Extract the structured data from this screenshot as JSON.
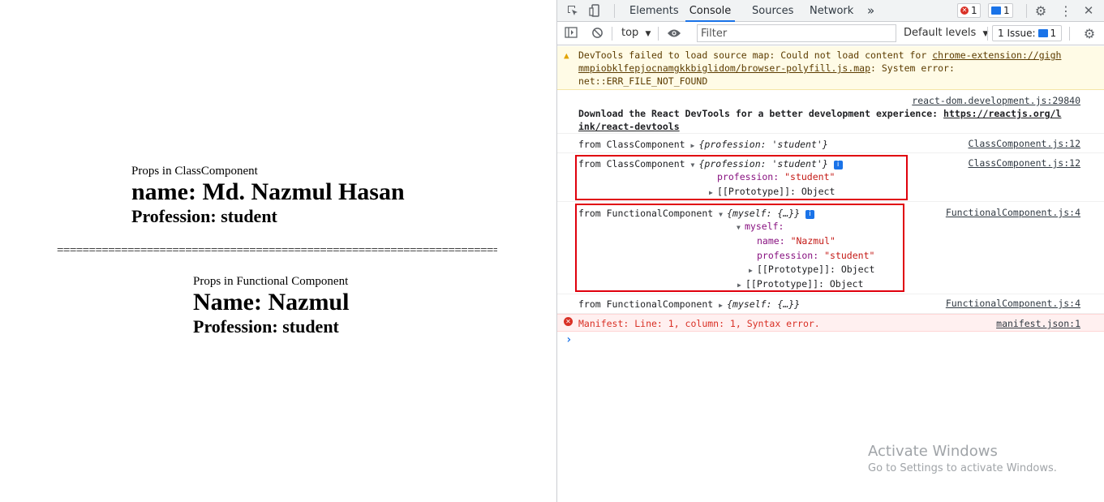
{
  "page": {
    "class_component": {
      "caption": "Props in ClassComponent",
      "name_line": "name: Md. Nazmul Hasan",
      "profession_line": "Profession: student"
    },
    "divider": "=========================================================================================================",
    "functional_component": {
      "caption": "Props in Functional Component",
      "name_line": "Name: Nazmul",
      "profession_line": "Profession: student"
    }
  },
  "devtools": {
    "tabs": [
      "Elements",
      "Console",
      "Sources",
      "Network"
    ],
    "active_tab": "Console",
    "more_tabs_glyph": "»",
    "error_count": "1",
    "message_count": "1",
    "toolbar": {
      "context": "top",
      "filter_placeholder": "Filter",
      "levels": "Default levels",
      "issues": "1 Issue:",
      "issues_count": "1"
    },
    "console": {
      "warning": {
        "prefix": "DevTools failed to load source map: Could not load content for ",
        "link_a": "chrome-extension://gigh",
        "link_b": "mmpiobklfepjocnamgkkbiglidom/browser-polyfill.js.map",
        "suffix": ": System error:",
        "line3": "net::ERR_FILE_NOT_FOUND"
      },
      "react_msg": {
        "source": "react-dom.development.js:29840",
        "text": "Download the React DevTools for a better development experience: ",
        "link_a": "https://reactjs.org/l",
        "link_b": "ink/react-devtools"
      },
      "class_log1": {
        "label": "from ClassComponent",
        "preview": "{profession: 'student'}",
        "source": "ClassComponent.js:12"
      },
      "class_log2": {
        "label": "from ClassComponent",
        "preview": "{profession: 'student'}",
        "prop_key": "profession:",
        "prop_val": "\"student\"",
        "proto": "[[Prototype]]: Object",
        "source": "ClassComponent.js:12"
      },
      "func_log1": {
        "label": "from FunctionalComponent",
        "preview": "{myself: {…}}",
        "myself_key": "myself:",
        "name_key": "name:",
        "name_val": "\"Nazmul\"",
        "prof_key": "profession:",
        "prof_val": "\"student\"",
        "proto_inner": "[[Prototype]]: Object",
        "proto_outer": "[[Prototype]]: Object",
        "source": "FunctionalComponent.js:4"
      },
      "func_log2": {
        "label": "from FunctionalComponent",
        "preview": "{myself: {…}}",
        "source": "FunctionalComponent.js:4"
      },
      "error": {
        "text": "Manifest: Line: 1, column: 1, Syntax error.",
        "source": "manifest.json:1"
      },
      "prompt": "›"
    }
  },
  "watermark": {
    "title": "Activate Windows",
    "subtitle": "Go to Settings to activate Windows."
  },
  "colors": {
    "accent": "#1a73e8",
    "highlight_box": "#e0000c",
    "warning_bg": "#fffbe6",
    "error_bg": "#fff0f0",
    "error_text": "#d93025"
  }
}
